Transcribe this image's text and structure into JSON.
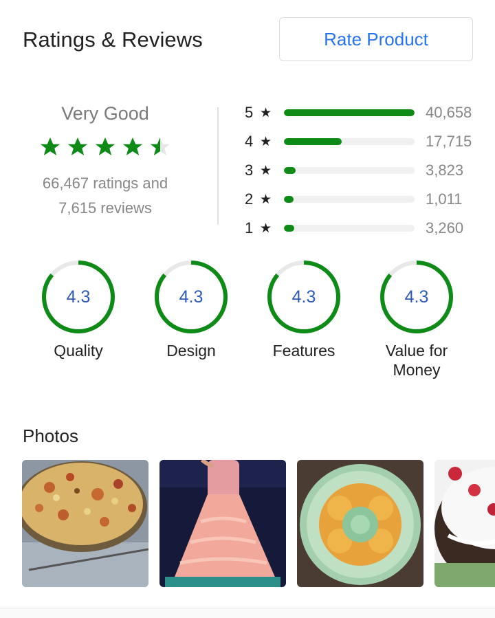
{
  "header": {
    "title": "Ratings & Reviews",
    "rate_button": "Rate Product"
  },
  "summary": {
    "label": "Very Good",
    "rating": 4.3,
    "stars_filled": 4.5,
    "ratings_text": "66,467 ratings and",
    "reviews_text": "7,615 reviews"
  },
  "distribution": [
    {
      "stars": "5",
      "count": "40,658",
      "fraction": 1.0
    },
    {
      "stars": "4",
      "count": "17,715",
      "fraction": 0.44
    },
    {
      "stars": "3",
      "count": "3,823",
      "fraction": 0.09
    },
    {
      "stars": "2",
      "count": "1,011",
      "fraction": 0.03
    },
    {
      "stars": "1",
      "count": "3,260",
      "fraction": 0.08
    }
  ],
  "metrics": [
    {
      "value": "4.3",
      "label": "Quality",
      "fraction": 0.86
    },
    {
      "value": "4.3",
      "label": "Design",
      "fraction": 0.86
    },
    {
      "value": "4.3",
      "label": "Features",
      "fraction": 0.86
    },
    {
      "value": "4.3",
      "label": "Value for Money",
      "fraction": 0.86
    }
  ],
  "photos": {
    "title": "Photos",
    "items": [
      "pizza-photo",
      "doll-cake-photo",
      "flower-cake-photo",
      "black-forest-cake-photo"
    ]
  },
  "colors": {
    "accent": "#2874f0",
    "green": "#0e8a16",
    "metric_value": "#2f5bb7"
  }
}
